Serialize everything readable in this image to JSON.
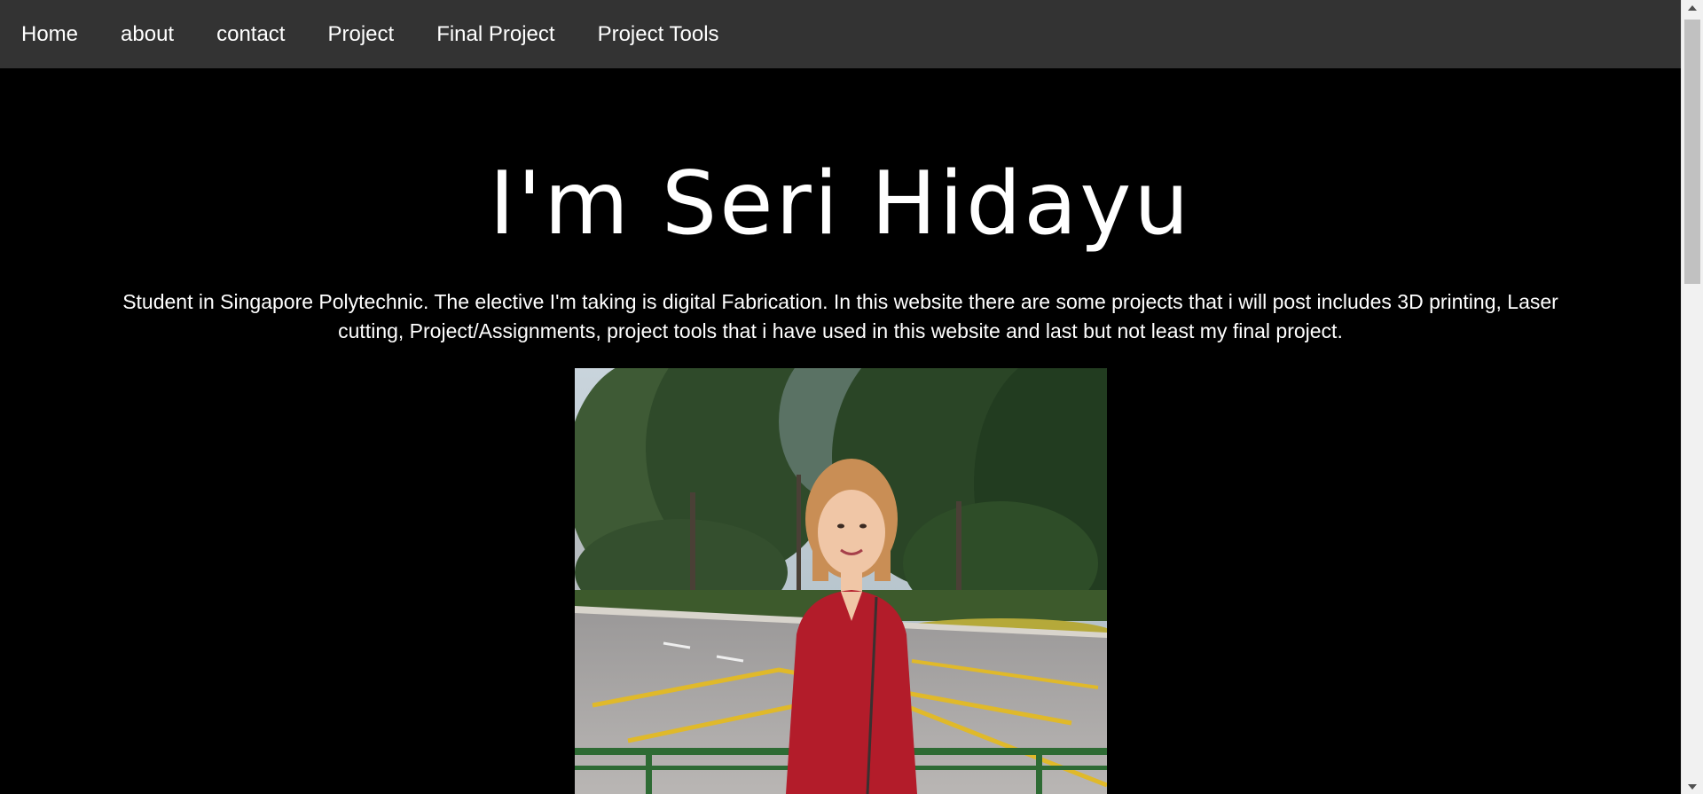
{
  "nav": {
    "items": [
      {
        "label": "Home"
      },
      {
        "label": "about"
      },
      {
        "label": "contact"
      },
      {
        "label": "Project"
      },
      {
        "label": "Final Project"
      },
      {
        "label": "Project Tools"
      }
    ]
  },
  "hero": {
    "title": "I'm Seri Hidayu",
    "intro": "Student in Singapore Polytechnic. The elective I'm taking is digital Fabrication. In this website there are some projects that i will post includes 3D printing, Laser cutting, Project/Assignments, project tools that i have used in this website and last but not least my final project."
  },
  "colors": {
    "navbar": "#333333",
    "background": "#000000",
    "text": "#ffffff"
  },
  "icons": {
    "scroll_up": "scroll-up-arrow-icon",
    "scroll_down": "scroll-down-arrow-icon"
  }
}
